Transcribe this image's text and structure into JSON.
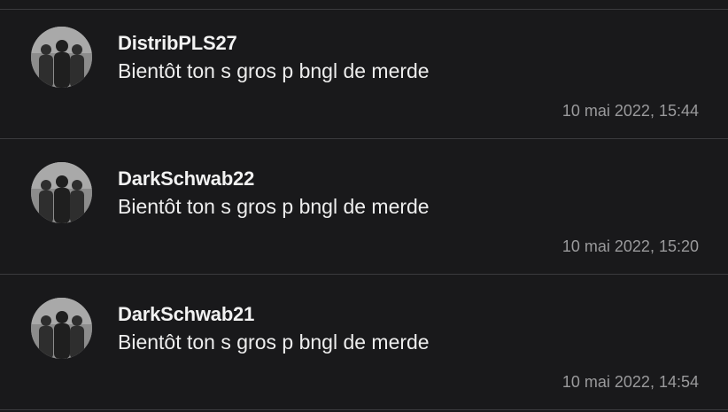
{
  "comments": [
    {
      "author": "DistribPLS27",
      "text": "Bientôt ton s gros p bngl de merde",
      "timestamp": "10 mai 2022, 15:44",
      "avatar_icon": "people-silhouette-avatar"
    },
    {
      "author": "DarkSchwab22",
      "text": "Bientôt ton s gros p bngl de merde",
      "timestamp": "10 mai 2022, 15:20",
      "avatar_icon": "people-silhouette-avatar"
    },
    {
      "author": "DarkSchwab21",
      "text": "Bientôt ton s gros p bngl de merde",
      "timestamp": "10 mai 2022, 14:54",
      "avatar_icon": "people-silhouette-avatar"
    }
  ],
  "colors": {
    "background": "#19191b",
    "divider": "#3b3b3e",
    "author": "#f2f2f2",
    "text": "#ededed",
    "timestamp": "#9a9a9c"
  }
}
